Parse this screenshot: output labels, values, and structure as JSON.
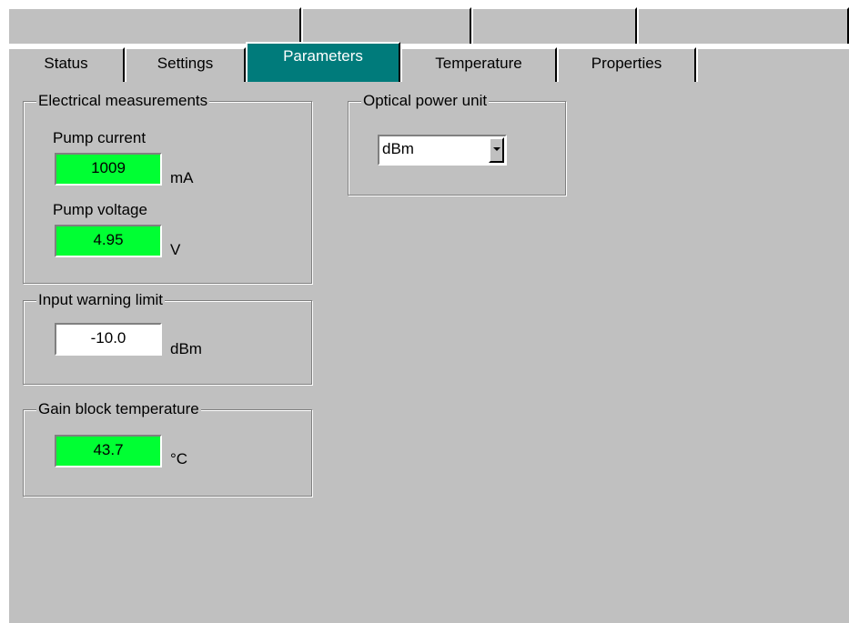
{
  "tabs_back": [
    "",
    "",
    "",
    ""
  ],
  "tabs": [
    {
      "label": "Status"
    },
    {
      "label": "Settings"
    },
    {
      "label": "Parameters",
      "active": true
    },
    {
      "label": "Temperature"
    },
    {
      "label": "Properties"
    }
  ],
  "electrical": {
    "title": "Electrical measurements",
    "pump_current_label": "Pump current",
    "pump_current_value": "1009",
    "pump_current_unit": "mA",
    "pump_voltage_label": "Pump voltage",
    "pump_voltage_value": "4.95",
    "pump_voltage_unit": "V"
  },
  "input_warning": {
    "title": "Input warning limit",
    "value": "-10.0",
    "unit": "dBm"
  },
  "gain_block": {
    "title": "Gain block temperature",
    "value": "43.7",
    "unit": "°C"
  },
  "optical_power": {
    "title": "Optical power unit",
    "selected": "dBm"
  },
  "colors": {
    "panel": "#c0c0c0",
    "active_tab": "#007b7b",
    "reading_bg": "#00ff33"
  }
}
